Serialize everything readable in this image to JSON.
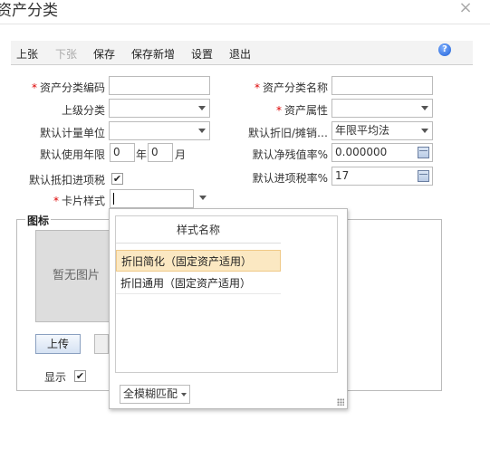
{
  "window": {
    "title": "资产分类"
  },
  "toolbar": {
    "prev": "上张",
    "next": "下张",
    "save": "保存",
    "save_new": "保存新增",
    "settings": "设置",
    "exit": "退出"
  },
  "form": {
    "code_label": "资产分类编码",
    "name_label": "资产分类名称",
    "parent_label": "上级分类",
    "property_label": "资产属性",
    "unit_label": "默认计量单位",
    "depr_label": "默认折旧/摊销…",
    "depr_value": "年限平均法",
    "life_label": "默认使用年限",
    "year_value": "0",
    "year_unit": "年",
    "month_value": "0",
    "month_unit": "月",
    "residual_label": "默认净残值率%",
    "residual_value": "0.000000",
    "deduct_label": "默认抵扣进项税",
    "tax_label": "默认进项税率%",
    "tax_value": "17",
    "card_label": "卡片样式"
  },
  "image_section": {
    "legend": "图标",
    "no_image": "暂无图片",
    "upload": "上传",
    "show_label": "显示"
  },
  "dropdown": {
    "header": "样式名称",
    "rows": [
      "折旧简化（固定资产适用）",
      "折旧通用（固定资产适用）"
    ],
    "filter_mode": "全模糊匹配"
  }
}
